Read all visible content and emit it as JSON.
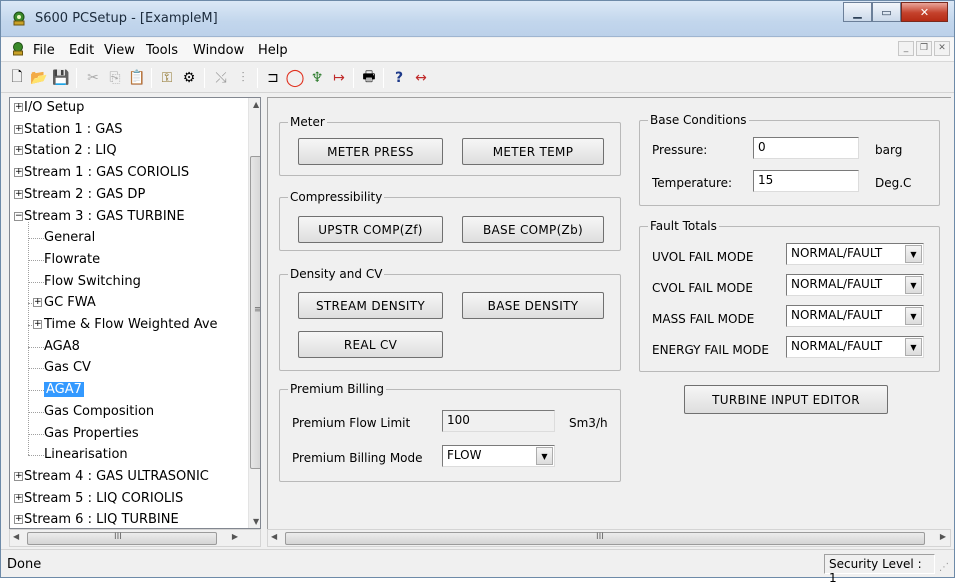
{
  "window": {
    "title": "S600 PCSetup - [ExampleM]",
    "caption_buttons": [
      "minimize-icon",
      "maximize-icon",
      "close-icon"
    ]
  },
  "menubar": {
    "items": [
      "File",
      "Edit",
      "View",
      "Tools",
      "Window",
      "Help"
    ]
  },
  "toolbar": {
    "icons": [
      "new-icon",
      "open-icon",
      "save-icon",
      "cut-icon",
      "copy-icon",
      "paste-icon",
      "key-icon",
      "connect-icon",
      "wiring-icon",
      "tune-icon",
      "link-icon",
      "stop-icon",
      "antenna-icon",
      "transfer-icon",
      "print-icon",
      "help-icon",
      "context-help-icon"
    ]
  },
  "tree": {
    "items": [
      {
        "label": "I/O Setup",
        "level": 0,
        "expander": "+"
      },
      {
        "label": "Station 1 : GAS",
        "level": 0,
        "expander": "+"
      },
      {
        "label": "Station 2 : LIQ",
        "level": 0,
        "expander": "+"
      },
      {
        "label": "Stream 1 : GAS CORIOLIS",
        "level": 0,
        "expander": "+"
      },
      {
        "label": "Stream 2 : GAS DP",
        "level": 0,
        "expander": "+"
      },
      {
        "label": "Stream 3 : GAS TURBINE",
        "level": 0,
        "expander": "-"
      },
      {
        "label": "General",
        "level": 1,
        "expander": ""
      },
      {
        "label": "Flowrate",
        "level": 1,
        "expander": ""
      },
      {
        "label": "Flow Switching",
        "level": 1,
        "expander": ""
      },
      {
        "label": "GC FWA",
        "level": 1,
        "expander": "+"
      },
      {
        "label": "Time & Flow Weighted Ave",
        "level": 1,
        "expander": "+"
      },
      {
        "label": "AGA8",
        "level": 1,
        "expander": ""
      },
      {
        "label": "Gas CV",
        "level": 1,
        "expander": ""
      },
      {
        "label": "AGA7",
        "level": 1,
        "expander": "",
        "selected": true
      },
      {
        "label": "Gas Composition",
        "level": 1,
        "expander": ""
      },
      {
        "label": "Gas Properties",
        "level": 1,
        "expander": ""
      },
      {
        "label": "Linearisation",
        "level": 1,
        "expander": ""
      },
      {
        "label": "Stream 4 : GAS ULTRASONIC",
        "level": 0,
        "expander": "+"
      },
      {
        "label": "Stream 5 : LIQ CORIOLIS",
        "level": 0,
        "expander": "+"
      },
      {
        "label": "Stream 6 : LIQ TURBINE",
        "level": 0,
        "expander": "+"
      }
    ],
    "scroll_thumb_glyph": "≡",
    "hscroll_thumb_glyph": "III"
  },
  "meter": {
    "title": "Meter",
    "press_button": "METER PRESS",
    "temp_button": "METER TEMP"
  },
  "compressibility": {
    "title": "Compressibility",
    "upstr_button": "UPSTR COMP(Zf)",
    "base_button": "BASE COMP(Zb)"
  },
  "density_cv": {
    "title": "Density and CV",
    "stream_density_button": "STREAM DENSITY",
    "base_density_button": "BASE DENSITY",
    "real_cv_button": "REAL CV"
  },
  "premium": {
    "title": "Premium Billing",
    "flow_limit_label": "Premium Flow Limit",
    "flow_limit_value": "100",
    "flow_limit_unit": "Sm3/h",
    "mode_label": "Premium Billing Mode",
    "mode_value": "FLOW"
  },
  "base_conditions": {
    "title": "Base Conditions",
    "pressure_label": "Pressure:",
    "pressure_value": "0",
    "pressure_unit": "barg",
    "temperature_label": "Temperature:",
    "temperature_value": "15",
    "temperature_unit": "Deg.C"
  },
  "fault_totals": {
    "title": "Fault Totals",
    "rows": [
      {
        "label": "UVOL FAIL MODE",
        "value": "NORMAL/FAULT"
      },
      {
        "label": "CVOL FAIL MODE",
        "value": "NORMAL/FAULT"
      },
      {
        "label": "MASS FAIL MODE",
        "value": "NORMAL/FAULT"
      },
      {
        "label": "ENERGY FAIL MODE",
        "value": "NORMAL/FAULT"
      }
    ]
  },
  "turbine_button": "TURBINE INPUT EDITOR",
  "main_hscroll_glyph": "III",
  "status": {
    "text": "Done",
    "security": "Security Level : 1"
  }
}
